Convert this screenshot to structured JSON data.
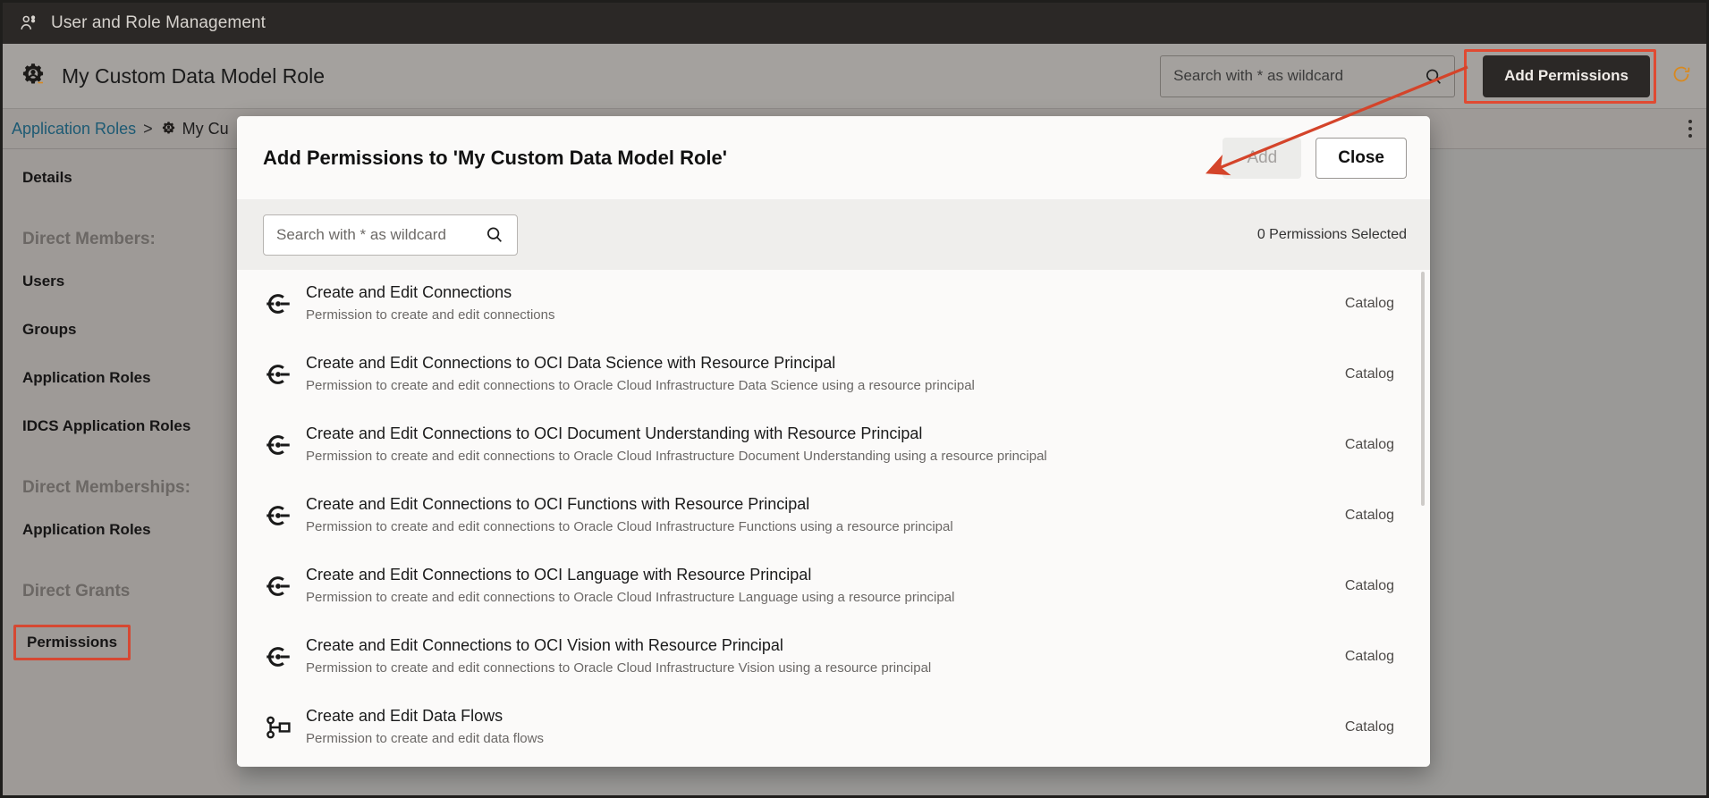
{
  "appbar": {
    "title": "User and Role Management",
    "icon": "users-icon"
  },
  "page_header": {
    "icon": "role-gear-icon",
    "title": "My Custom Data Model Role",
    "search": {
      "placeholder": "Search with * as wildcard",
      "value": "",
      "icon": "search-icon"
    },
    "add_permissions_label": "Add Permissions",
    "refresh_icon": "refresh-icon",
    "highlight_color": "#e04a32"
  },
  "breadcrumb": {
    "root_label": "Application Roles",
    "separator": ">",
    "current_icon": "role-gear-icon",
    "current_label": "My Cu",
    "overflow_menu_icon": "kebab-menu-icon"
  },
  "sidebar": {
    "items": [
      {
        "label": "Details",
        "type": "item",
        "highlighted": false
      },
      {
        "label": "Direct Members:",
        "type": "group"
      },
      {
        "label": "Users",
        "type": "item",
        "highlighted": false
      },
      {
        "label": "Groups",
        "type": "item",
        "highlighted": false
      },
      {
        "label": "Application Roles",
        "type": "item",
        "highlighted": false
      },
      {
        "label": "IDCS Application Roles",
        "type": "item",
        "highlighted": false
      },
      {
        "label": "Direct Memberships:",
        "type": "group"
      },
      {
        "label": "Application Roles",
        "type": "item",
        "highlighted": false
      },
      {
        "label": "Direct Grants",
        "type": "group"
      },
      {
        "label": "Permissions",
        "type": "item",
        "highlighted": true
      }
    ]
  },
  "dialog": {
    "title": "Add Permissions to 'My Custom Data Model Role'",
    "add_label": "Add",
    "add_disabled": true,
    "close_label": "Close",
    "search": {
      "placeholder": "Search with * as wildcard",
      "value": "",
      "icon": "search-icon"
    },
    "selected_count_text": "0 Permissions Selected",
    "permissions": [
      {
        "icon": "connection-icon",
        "title": "Create and Edit Connections",
        "description": "Permission to create and edit connections",
        "category": "Catalog"
      },
      {
        "icon": "connection-icon",
        "title": "Create and Edit Connections to OCI Data Science with Resource Principal",
        "description": "Permission to create and edit connections to Oracle Cloud Infrastructure Data Science using a resource principal",
        "category": "Catalog"
      },
      {
        "icon": "connection-icon",
        "title": "Create and Edit Connections to OCI Document Understanding with Resource Principal",
        "description": "Permission to create and edit connections to Oracle Cloud Infrastructure Document Understanding using a resource principal",
        "category": "Catalog"
      },
      {
        "icon": "connection-icon",
        "title": "Create and Edit Connections to OCI Functions with Resource Principal",
        "description": "Permission to create and edit connections to Oracle Cloud Infrastructure Functions using a resource principal",
        "category": "Catalog"
      },
      {
        "icon": "connection-icon",
        "title": "Create and Edit Connections to OCI Language with Resource Principal",
        "description": "Permission to create and edit connections to Oracle Cloud Infrastructure Language using a resource principal",
        "category": "Catalog"
      },
      {
        "icon": "connection-icon",
        "title": "Create and Edit Connections to OCI Vision with Resource Principal",
        "description": "Permission to create and edit connections to Oracle Cloud Infrastructure Vision using a resource principal",
        "category": "Catalog"
      },
      {
        "icon": "dataflow-icon",
        "title": "Create and Edit Data Flows",
        "description": "Permission to create and edit data flows",
        "category": "Catalog"
      }
    ]
  },
  "annotation": {
    "arrow_color": "#d4442a",
    "highlight_color": "#e04a32"
  }
}
